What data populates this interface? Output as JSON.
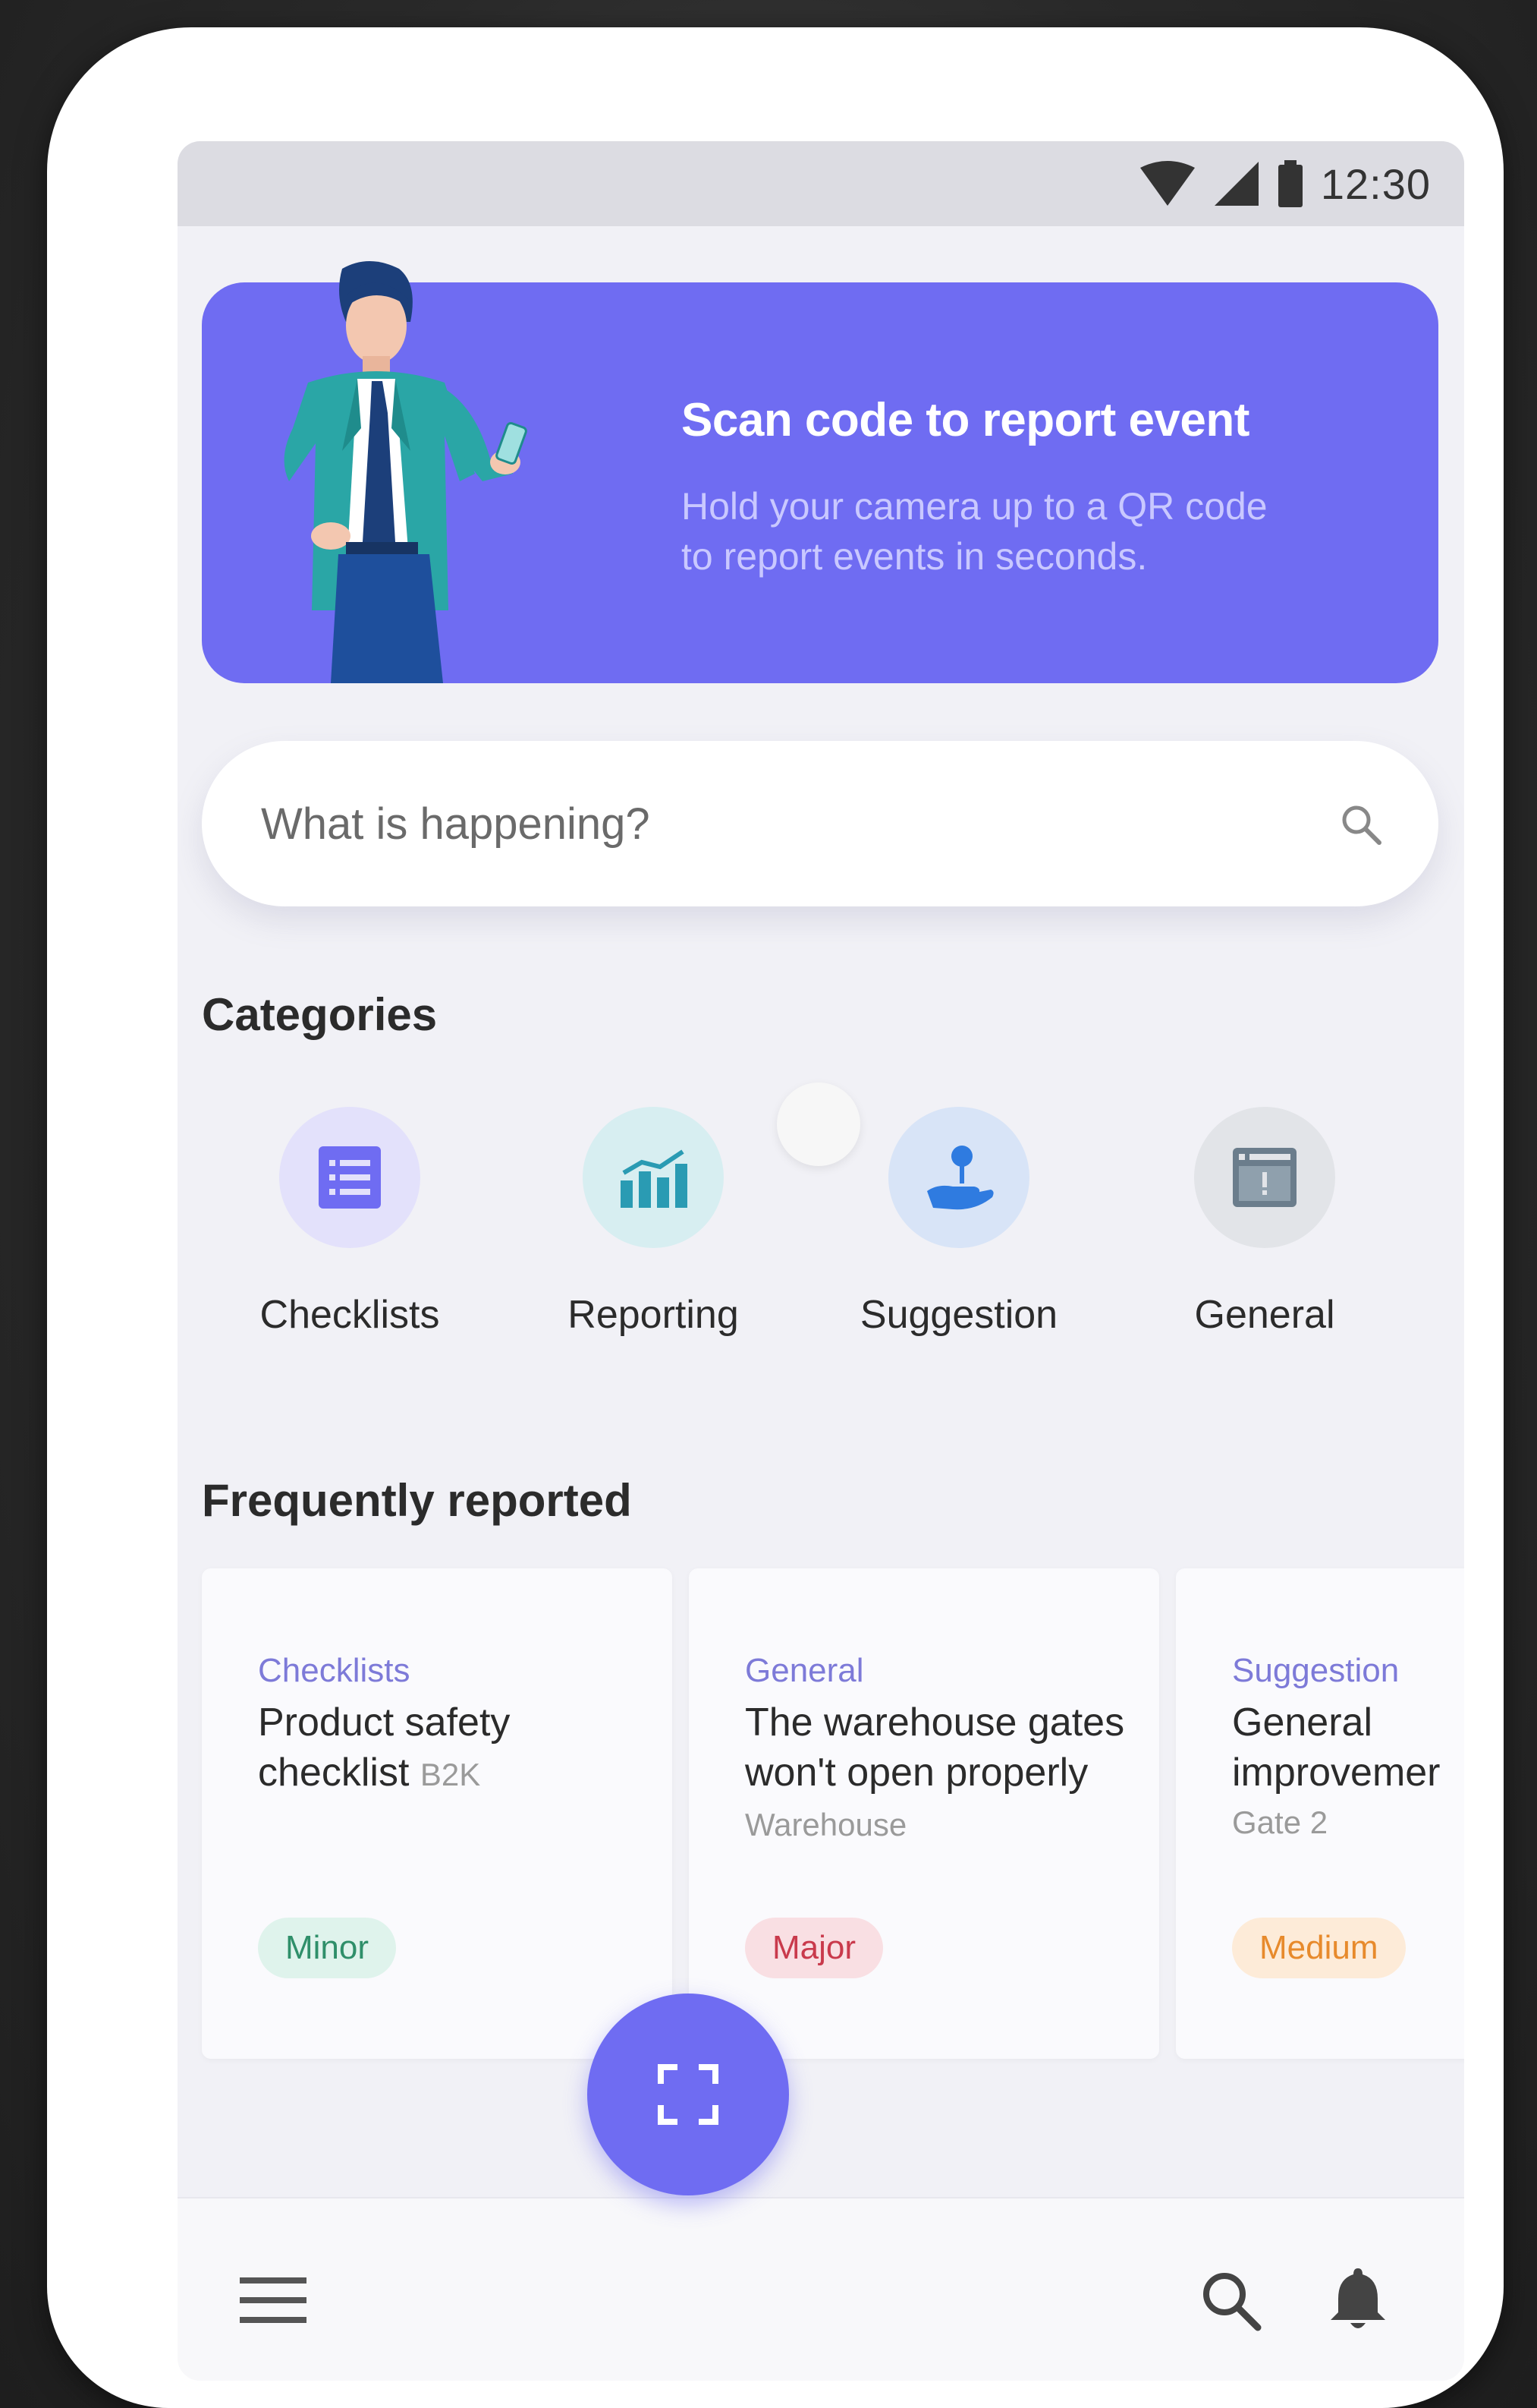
{
  "status_bar": {
    "time": "12:30"
  },
  "banner": {
    "title": "Scan code to report event",
    "description_line1": "Hold your camera up to a QR code",
    "description_line2": "to report events in seconds."
  },
  "search": {
    "placeholder": "What is happening?"
  },
  "categories": {
    "title": "Categories",
    "items": [
      {
        "label": "Checklists",
        "icon": "checklist-icon",
        "bg": "#e3e1fb",
        "color": "#6f6cf2"
      },
      {
        "label": "Reporting",
        "icon": "bar-chart-icon",
        "bg": "#d7eef1",
        "color": "#2a9bb3"
      },
      {
        "label": "Suggestion",
        "icon": "hand-pin-icon",
        "bg": "#d8e4f7",
        "color": "#2f7be0"
      },
      {
        "label": "General",
        "icon": "window-alert-icon",
        "bg": "#e2e4e8",
        "color": "#6b7d8c"
      }
    ]
  },
  "frequently_reported": {
    "title": "Frequently reported",
    "cards": [
      {
        "category": "Checklists",
        "title": "Product safety checklist",
        "location": "B2K",
        "severity": "Minor",
        "severity_bg": "#dff3ec",
        "severity_color": "#2f8f6a"
      },
      {
        "category": "General",
        "title": "The warehouse gates won't open properly",
        "location": "Warehouse",
        "severity": "Major",
        "severity_bg": "#f9dfe3",
        "severity_color": "#c93a4c"
      },
      {
        "category": "Suggestion",
        "title": "General improvemer",
        "location": "Gate 2",
        "severity": "Medium",
        "severity_bg": "#fdebd8",
        "severity_color": "#e78a2c"
      }
    ]
  },
  "bottom_nav": {
    "menu_icon": "menu-icon",
    "scan_icon": "scan-icon",
    "search_icon": "search-icon",
    "bell_icon": "bell-icon"
  },
  "colors": {
    "accent": "#6f6cf2",
    "background": "#f1f1f6"
  }
}
